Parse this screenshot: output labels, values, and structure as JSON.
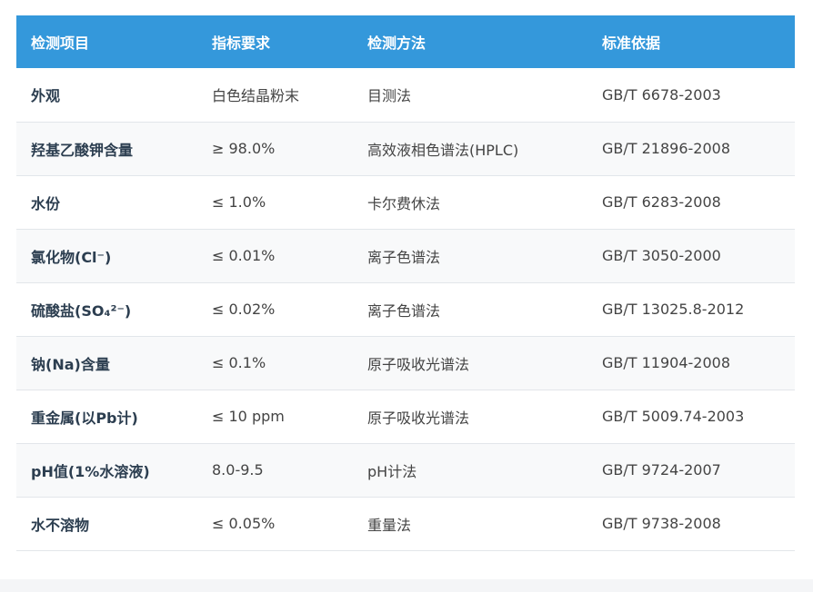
{
  "table": {
    "headers": [
      "检测项目",
      "指标要求",
      "检测方法",
      "标准依据"
    ],
    "rows": [
      {
        "item": "外观",
        "requirement": "白色结晶粉末",
        "method": "目测法",
        "standard": "GB/T 6678-2003"
      },
      {
        "item": "羟基乙酸钾含量",
        "requirement": "≥ 98.0%",
        "method": "高效液相色谱法(HPLC)",
        "standard": "GB/T 21896-2008"
      },
      {
        "item": "水份",
        "requirement": "≤ 1.0%",
        "method": "卡尔费休法",
        "standard": "GB/T 6283-2008"
      },
      {
        "item": "氯化物(Cl⁻)",
        "requirement": "≤ 0.01%",
        "method": "离子色谱法",
        "standard": "GB/T 3050-2000"
      },
      {
        "item": "硫酸盐(SO₄²⁻)",
        "requirement": "≤ 0.02%",
        "method": "离子色谱法",
        "standard": "GB/T 13025.8-2012"
      },
      {
        "item": "钠(Na)含量",
        "requirement": "≤ 0.1%",
        "method": "原子吸收光谱法",
        "standard": "GB/T 11904-2008"
      },
      {
        "item": "重金属(以Pb计)",
        "requirement": "≤ 10 ppm",
        "method": "原子吸收光谱法",
        "standard": "GB/T 5009.74-2003"
      },
      {
        "item": "pH值(1%水溶液)",
        "requirement": "8.0-9.5",
        "method": "pH计法",
        "standard": "GB/T 9724-2007"
      },
      {
        "item": "水不溶物",
        "requirement": "≤ 0.05%",
        "method": "重量法",
        "standard": "GB/T 9738-2008"
      }
    ]
  },
  "colors": {
    "header_bg": "#3498db",
    "header_text": "#ffffff",
    "alt_row": "#f8f9fa"
  }
}
